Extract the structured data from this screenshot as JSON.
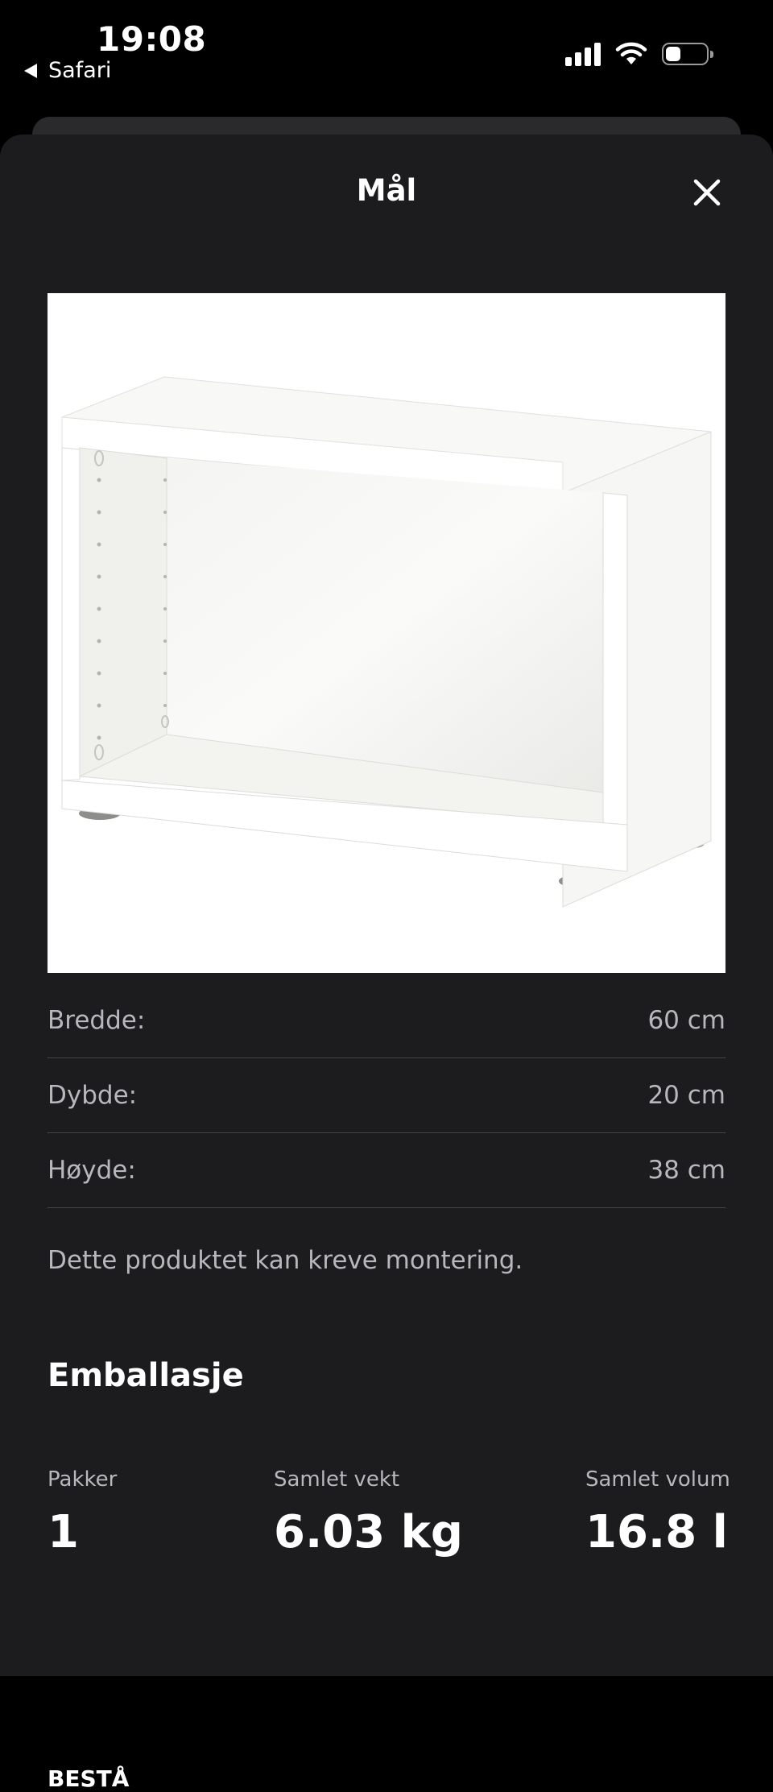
{
  "status_bar": {
    "time": "19:08",
    "back_app": "Safari"
  },
  "sheet": {
    "title": "Mål"
  },
  "dimensions": [
    {
      "label": "Bredde:",
      "value": "60 cm"
    },
    {
      "label": "Dybde:",
      "value": "20 cm"
    },
    {
      "label": "Høyde:",
      "value": "38 cm"
    }
  ],
  "assembly_note": "Dette produktet kan kreve montering.",
  "packaging": {
    "heading": "Emballasje",
    "packages_label": "Pakker",
    "packages_value": "1",
    "weight_label": "Samlet vekt",
    "weight_value": "6.03 kg",
    "volume_label": "Samlet volum",
    "volume_value": "16.8 l"
  },
  "product_name": "BESTÅ",
  "icons": {
    "back": "back-triangle-icon",
    "close": "close-icon",
    "signal": "cellular-signal-icon",
    "wifi": "wifi-icon",
    "battery": "battery-icon"
  }
}
